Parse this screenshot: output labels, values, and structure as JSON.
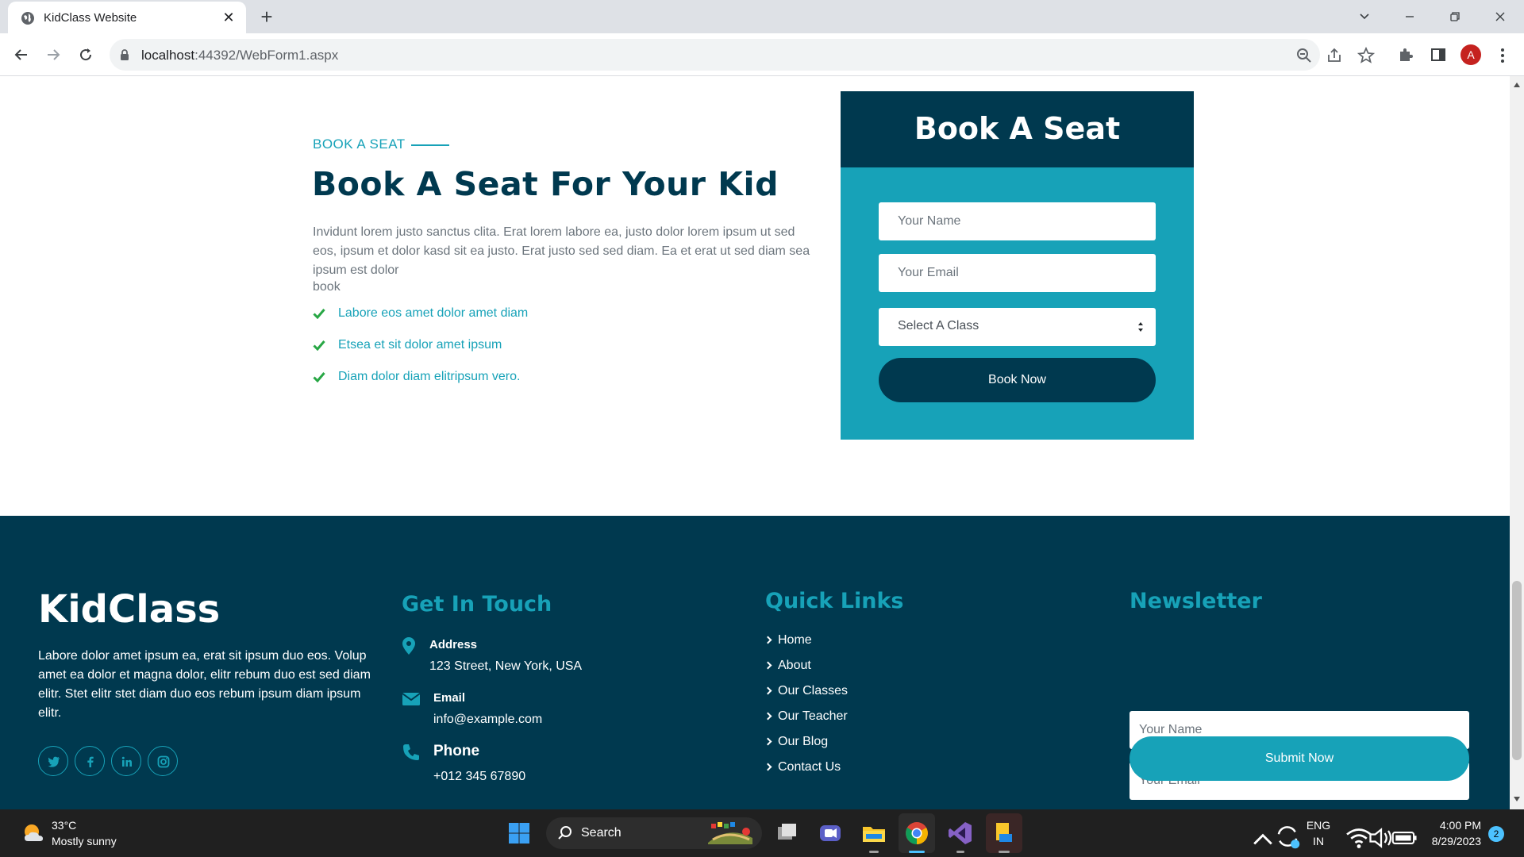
{
  "browser": {
    "tab_title": "KidClass Website",
    "url_host": "localhost",
    "url_path": ":44392/WebForm1.aspx",
    "avatar_letter": "A"
  },
  "booking": {
    "eyebrow": "BOOK A SEAT",
    "heading": "Book A Seat For Your Kid",
    "paragraph": "Invidunt lorem justo sanctus clita. Erat lorem labore ea, justo dolor lorem ipsum ut sed eos, ipsum et dolor kasd sit ea justo. Erat justo sed sed diam. Ea et erat ut sed diam sea ipsum est dolor",
    "paragraph_tail": "book",
    "checklist": [
      "Labore eos amet dolor amet diam",
      "Etsea et sit dolor amet ipsum",
      "Diam dolor diam elitripsum vero."
    ],
    "form": {
      "title": "Book A Seat",
      "name_placeholder": "Your Name",
      "email_placeholder": "Your Email",
      "select_value": "Select A Class",
      "button_label": "Book Now"
    }
  },
  "footer": {
    "brand": "KidClass",
    "description": "Labore dolor amet ipsum ea, erat sit ipsum duo eos. Volup amet ea dolor et magna dolor, elitr rebum duo est sed diam elitr. Stet elitr stet diam duo eos rebum ipsum diam ipsum elitr.",
    "contact": {
      "title": "Get In Touch",
      "address_label": "Address",
      "address_value": "123 Street, New York, USA",
      "email_label": "Email",
      "email_value": "info@example.com",
      "phone_label": "Phone",
      "phone_value": "+012 345 67890"
    },
    "quick_links": {
      "title": "Quick Links",
      "items": [
        "Home",
        "About",
        "Our Classes",
        "Our Teacher",
        "Our Blog",
        "Contact Us"
      ]
    },
    "newsletter": {
      "title": "Newsletter",
      "name_placeholder": "Your Name",
      "email_placeholder": "Your Email",
      "button_label": "Submit Now"
    }
  },
  "taskbar": {
    "weather_temp": "33°C",
    "weather_desc": "Mostly sunny",
    "search_label": "Search",
    "lang_top": "ENG",
    "lang_bottom": "IN",
    "time": "4:00 PM",
    "date": "8/29/2023",
    "notification_count": "2"
  },
  "colors": {
    "primary": "#17a2b8",
    "dark": "#00394f",
    "text_muted": "#6c757d"
  }
}
